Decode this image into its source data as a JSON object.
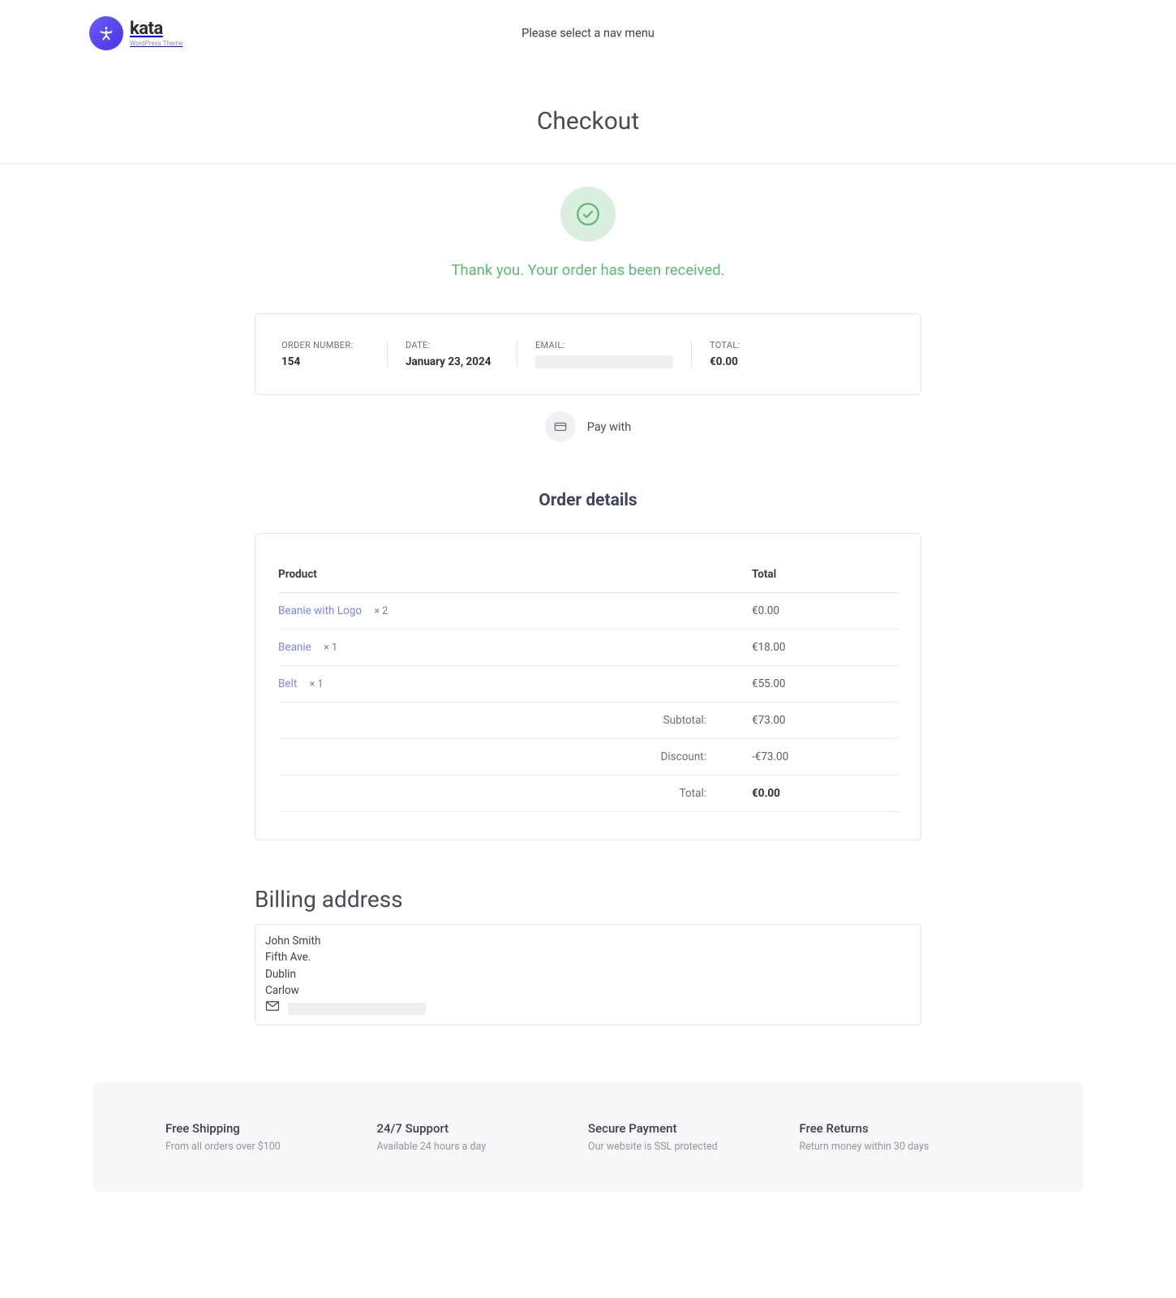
{
  "header": {
    "logo_name": "kata",
    "logo_sub": "WordPress Theme",
    "nav_message": "Please select a nav menu"
  },
  "page": {
    "title": "Checkout",
    "thank_you": "Thank you. Your order has been received."
  },
  "overview": {
    "order_number_label": "ORDER NUMBER:",
    "order_number": "154",
    "date_label": "DATE:",
    "date": "January 23, 2024",
    "email_label": "EMAIL:",
    "total_label": "TOTAL:",
    "total": "€0.00"
  },
  "pay_with_label": "Pay with",
  "order_details": {
    "heading": "Order details",
    "col_product": "Product",
    "col_total": "Total",
    "items": [
      {
        "name": "Beanie with Logo",
        "qty": "× 2",
        "total": "€0.00"
      },
      {
        "name": "Beanie",
        "qty": "× 1",
        "total": "€18.00"
      },
      {
        "name": "Belt",
        "qty": "× 1",
        "total": "€55.00"
      }
    ],
    "subtotal_label": "Subtotal:",
    "subtotal": "€73.00",
    "discount_label": "Discount:",
    "discount": "-€73.00",
    "total_label": "Total:",
    "total": "€0.00"
  },
  "billing": {
    "heading": "Billing address",
    "name": "John Smith",
    "line1": "Fifth Ave.",
    "city": "Dublin",
    "region": "Carlow"
  },
  "features": [
    {
      "title": "Free Shipping",
      "sub": "From all orders over $100"
    },
    {
      "title": "24/7 Support",
      "sub": "Available 24 hours a day"
    },
    {
      "title": "Secure Payment",
      "sub": "Our website is SSL protected"
    },
    {
      "title": "Free Returns",
      "sub": "Return money within 30 days"
    }
  ]
}
